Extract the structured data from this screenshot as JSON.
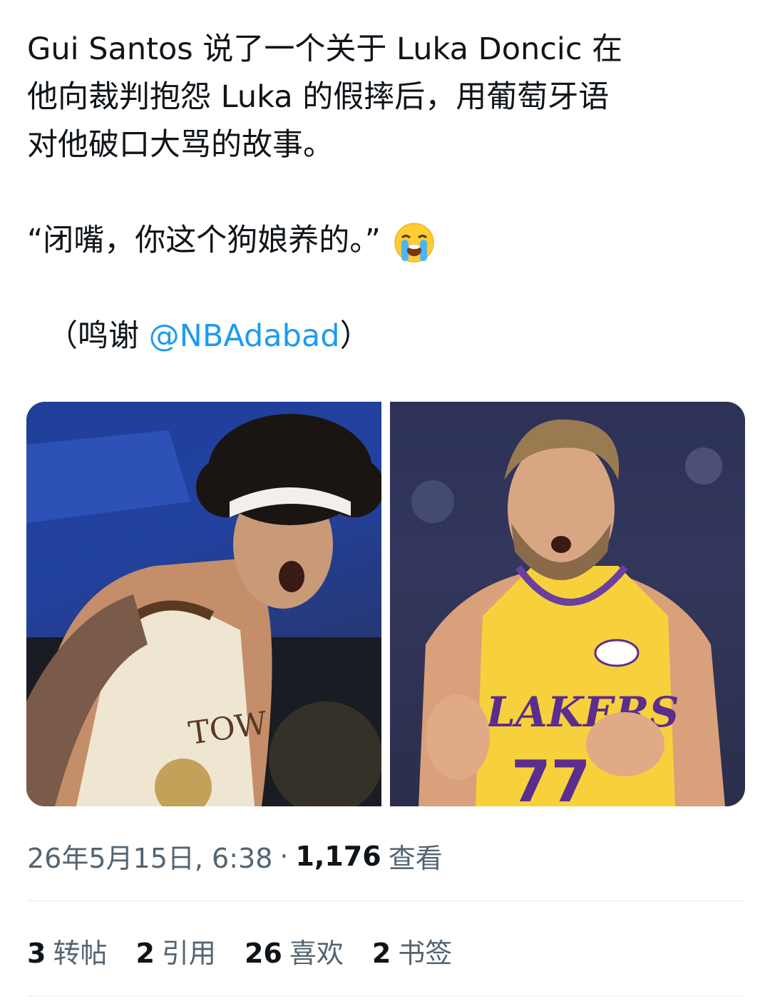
{
  "tweet": {
    "line1": "Gui Santos 说了一个关于 Luka Doncic 在",
    "line2": "他向裁判抱怨 Luka 的假摔后，用葡萄牙语",
    "line3": "对他破口大骂的故事。",
    "quote": "“闭嘴，你这个狗娘养的。”",
    "emoji": "loudly-crying-face",
    "credit_prefix": "（鸣谢 ",
    "credit_mention": "@NBAdabad",
    "credit_suffix": "）"
  },
  "media": {
    "left_photo": "Gui Santos in Warriors 'The Town' jersey shouting",
    "right_photo": "Luka Doncic in Lakers #77 jersey gesturing"
  },
  "meta": {
    "date": "26年5月15日, 6:38",
    "separator": "·",
    "views_count": "1,176",
    "views_label": "查看"
  },
  "stats": {
    "reposts_count": "3",
    "reposts_label": "转帖",
    "quotes_count": "2",
    "quotes_label": "引用",
    "likes_count": "26",
    "likes_label": "喜欢",
    "bookmarks_count": "2",
    "bookmarks_label": "书签"
  },
  "colors": {
    "link": "#1d9bf0",
    "secondary": "#536471",
    "primary": "#0f1419",
    "divider": "#e6e9ec"
  }
}
